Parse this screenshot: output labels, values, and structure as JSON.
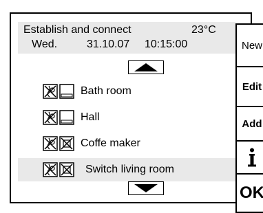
{
  "header": {
    "status": "Establish and connect",
    "temperature": "23°C",
    "day": "Wed.",
    "date": "31.10.07",
    "time": "10:15:00"
  },
  "buttons": {
    "new": "New",
    "edit": "Edit",
    "add": "Add",
    "info": "i",
    "ok": "OK"
  },
  "list": [
    {
      "label": "Bath room",
      "icon": "lamp-off-icon",
      "state_checked": false
    },
    {
      "label": "Hall",
      "icon": "lamp-off-icon",
      "state_checked": false
    },
    {
      "label": "Coffe maker",
      "icon": "lamp-off-icon",
      "state_checked": true
    },
    {
      "label": "Switch living room",
      "icon": "lamp-off-icon",
      "state_checked": true,
      "selected": true
    }
  ],
  "icons": {
    "scroll_up": "triangle-up-icon",
    "scroll_down": "triangle-down-icon",
    "info": "info-icon"
  }
}
